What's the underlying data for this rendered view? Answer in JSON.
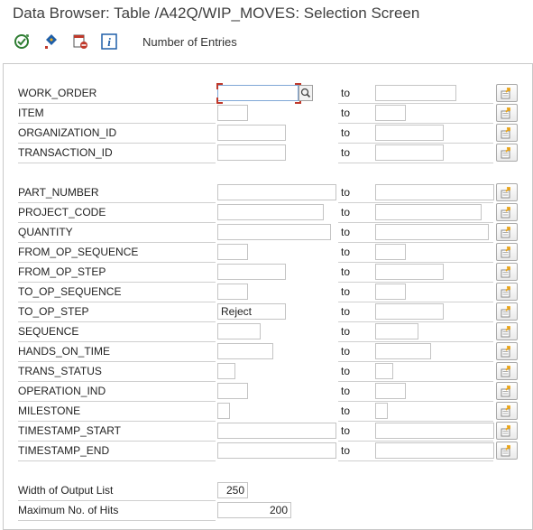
{
  "window": {
    "title": "Data Browser: Table /A42Q/WIP_MOVES: Selection Screen"
  },
  "toolbar": {
    "icons": [
      "execute-icon",
      "selection-options-icon",
      "delete-selection-icon",
      "info-icon"
    ],
    "number_of_entries_label": "Number of Entries"
  },
  "to_label": "to",
  "rows": [
    {
      "label": "WORK_ORDER",
      "from_value": "",
      "to_value": ""
    },
    {
      "label": "ITEM",
      "from_value": "",
      "to_value": ""
    },
    {
      "label": "ORGANIZATION_ID",
      "from_value": "",
      "to_value": ""
    },
    {
      "label": "TRANSACTION_ID",
      "from_value": "",
      "to_value": ""
    },
    {
      "label": "PART_NUMBER",
      "from_value": "",
      "to_value": ""
    },
    {
      "label": "PROJECT_CODE",
      "from_value": "",
      "to_value": ""
    },
    {
      "label": "QUANTITY",
      "from_value": "",
      "to_value": ""
    },
    {
      "label": "FROM_OP_SEQUENCE",
      "from_value": "",
      "to_value": ""
    },
    {
      "label": "FROM_OP_STEP",
      "from_value": "",
      "to_value": ""
    },
    {
      "label": "TO_OP_SEQUENCE",
      "from_value": "",
      "to_value": ""
    },
    {
      "label": "TO_OP_STEP",
      "from_value": "Reject",
      "to_value": ""
    },
    {
      "label": "SEQUENCE",
      "from_value": "",
      "to_value": ""
    },
    {
      "label": "HANDS_ON_TIME",
      "from_value": "",
      "to_value": ""
    },
    {
      "label": "TRANS_STATUS",
      "from_value": "",
      "to_value": ""
    },
    {
      "label": "OPERATION_IND",
      "from_value": "",
      "to_value": ""
    },
    {
      "label": "MILESTONE",
      "from_value": "",
      "to_value": ""
    },
    {
      "label": "TIMESTAMP_START",
      "from_value": "",
      "to_value": ""
    },
    {
      "label": "TIMESTAMP_END",
      "from_value": "",
      "to_value": ""
    }
  ],
  "settings": {
    "width_label": "Width of Output List",
    "width_value": "250",
    "max_hits_label": "Maximum No. of Hits",
    "max_hits_value": "200"
  },
  "colors": {
    "focus": "#c0392b",
    "select_arrow": "#e8a317",
    "info_blue": "#1f5fa8"
  }
}
